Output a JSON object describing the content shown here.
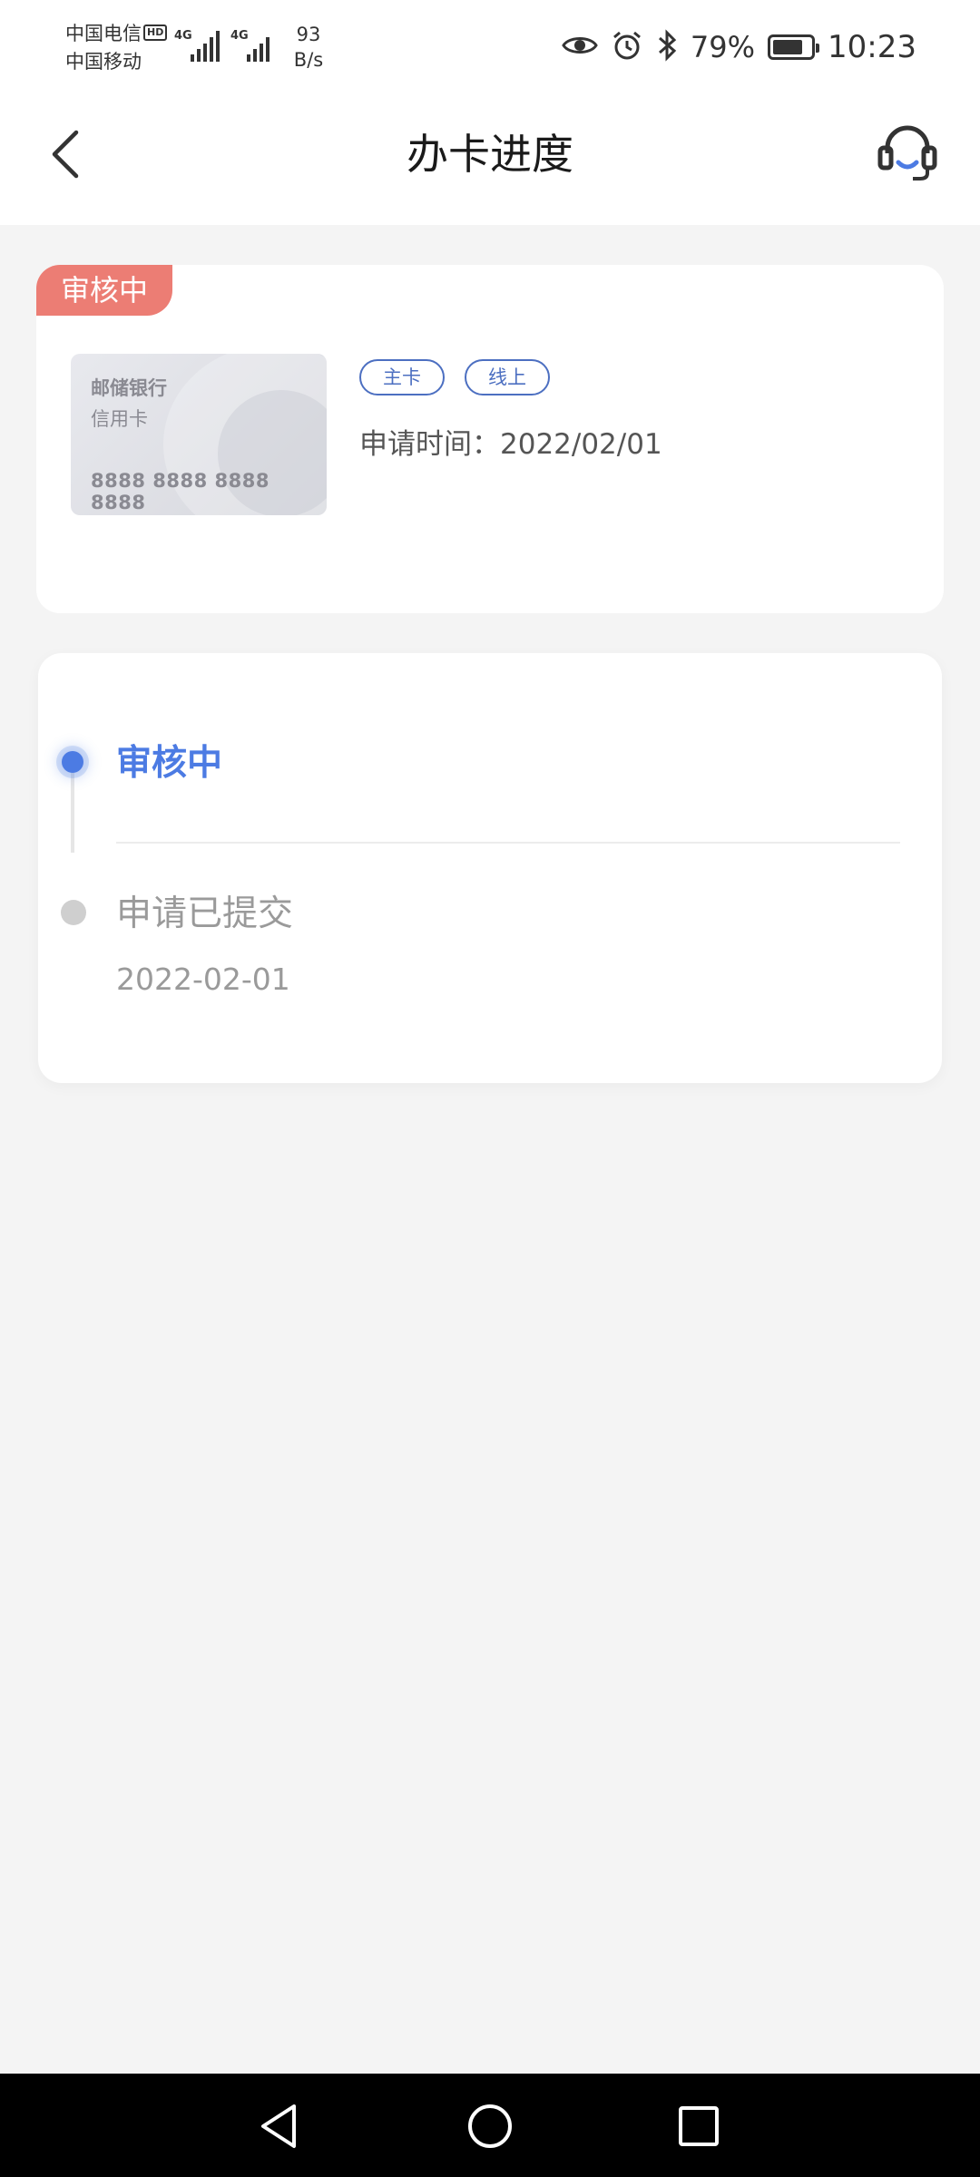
{
  "status_bar": {
    "carrier_1": "中国电信",
    "carrier_1_badge": "HD",
    "carrier_2": "中国移动",
    "network_1": "4G",
    "network_2": "4G",
    "net_speed_value": "93",
    "net_speed_unit": "B/s",
    "battery_percent": "79%",
    "battery_level": 0.79,
    "time": "10:23"
  },
  "nav": {
    "title": "办卡进度"
  },
  "card_summary": {
    "status_ribbon": "审核中",
    "card": {
      "bank_name": "邮储银行",
      "card_type": "信用卡",
      "card_number": "8888 8888 8888 8888"
    },
    "tags": [
      "主卡",
      "线上"
    ],
    "apply_time": "申请时间：2022/02/01"
  },
  "timeline": {
    "steps": [
      {
        "title": "审核中",
        "date": ""
      },
      {
        "title": "申请已提交",
        "date": "2022-02-01"
      }
    ]
  },
  "colors": {
    "accent": "#4c7be3",
    "ribbon": "#ec7d74",
    "tag": "#4c6fc1"
  }
}
